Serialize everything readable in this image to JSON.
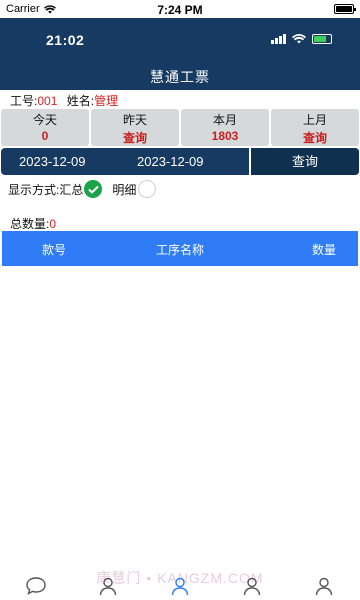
{
  "status_bar": {
    "carrier": "Carrier",
    "time": "7:24 PM"
  },
  "app_status": {
    "time": "21:02"
  },
  "header": {
    "title": "慧通工票"
  },
  "worker": {
    "id_label": "工号:",
    "id_value": "001",
    "name_label": "姓名:",
    "name_value": "管理"
  },
  "stats": [
    {
      "label": "今天",
      "value": "0"
    },
    {
      "label": "昨天",
      "value": "查询"
    },
    {
      "label": "本月",
      "value": "1803"
    },
    {
      "label": "上月",
      "value": "查询"
    }
  ],
  "date_range": {
    "start": "2023-12-09",
    "end": "2023-12-09",
    "query_label": "查询"
  },
  "display_mode": {
    "label": "显示方式:",
    "option_summary": "汇总",
    "option_detail": "明细",
    "selected": "汇总"
  },
  "total": {
    "label": "总数量:",
    "value": "0"
  },
  "table": {
    "columns": [
      "款号",
      "工序名称",
      "数量"
    ]
  },
  "watermark": "康慧门 • KANGZM.COM",
  "colors": {
    "header_bg": "#163a62",
    "table_header_bg": "#2f7cf6",
    "accent_red": "#c81e1e",
    "radio_green": "#1aa34a"
  }
}
